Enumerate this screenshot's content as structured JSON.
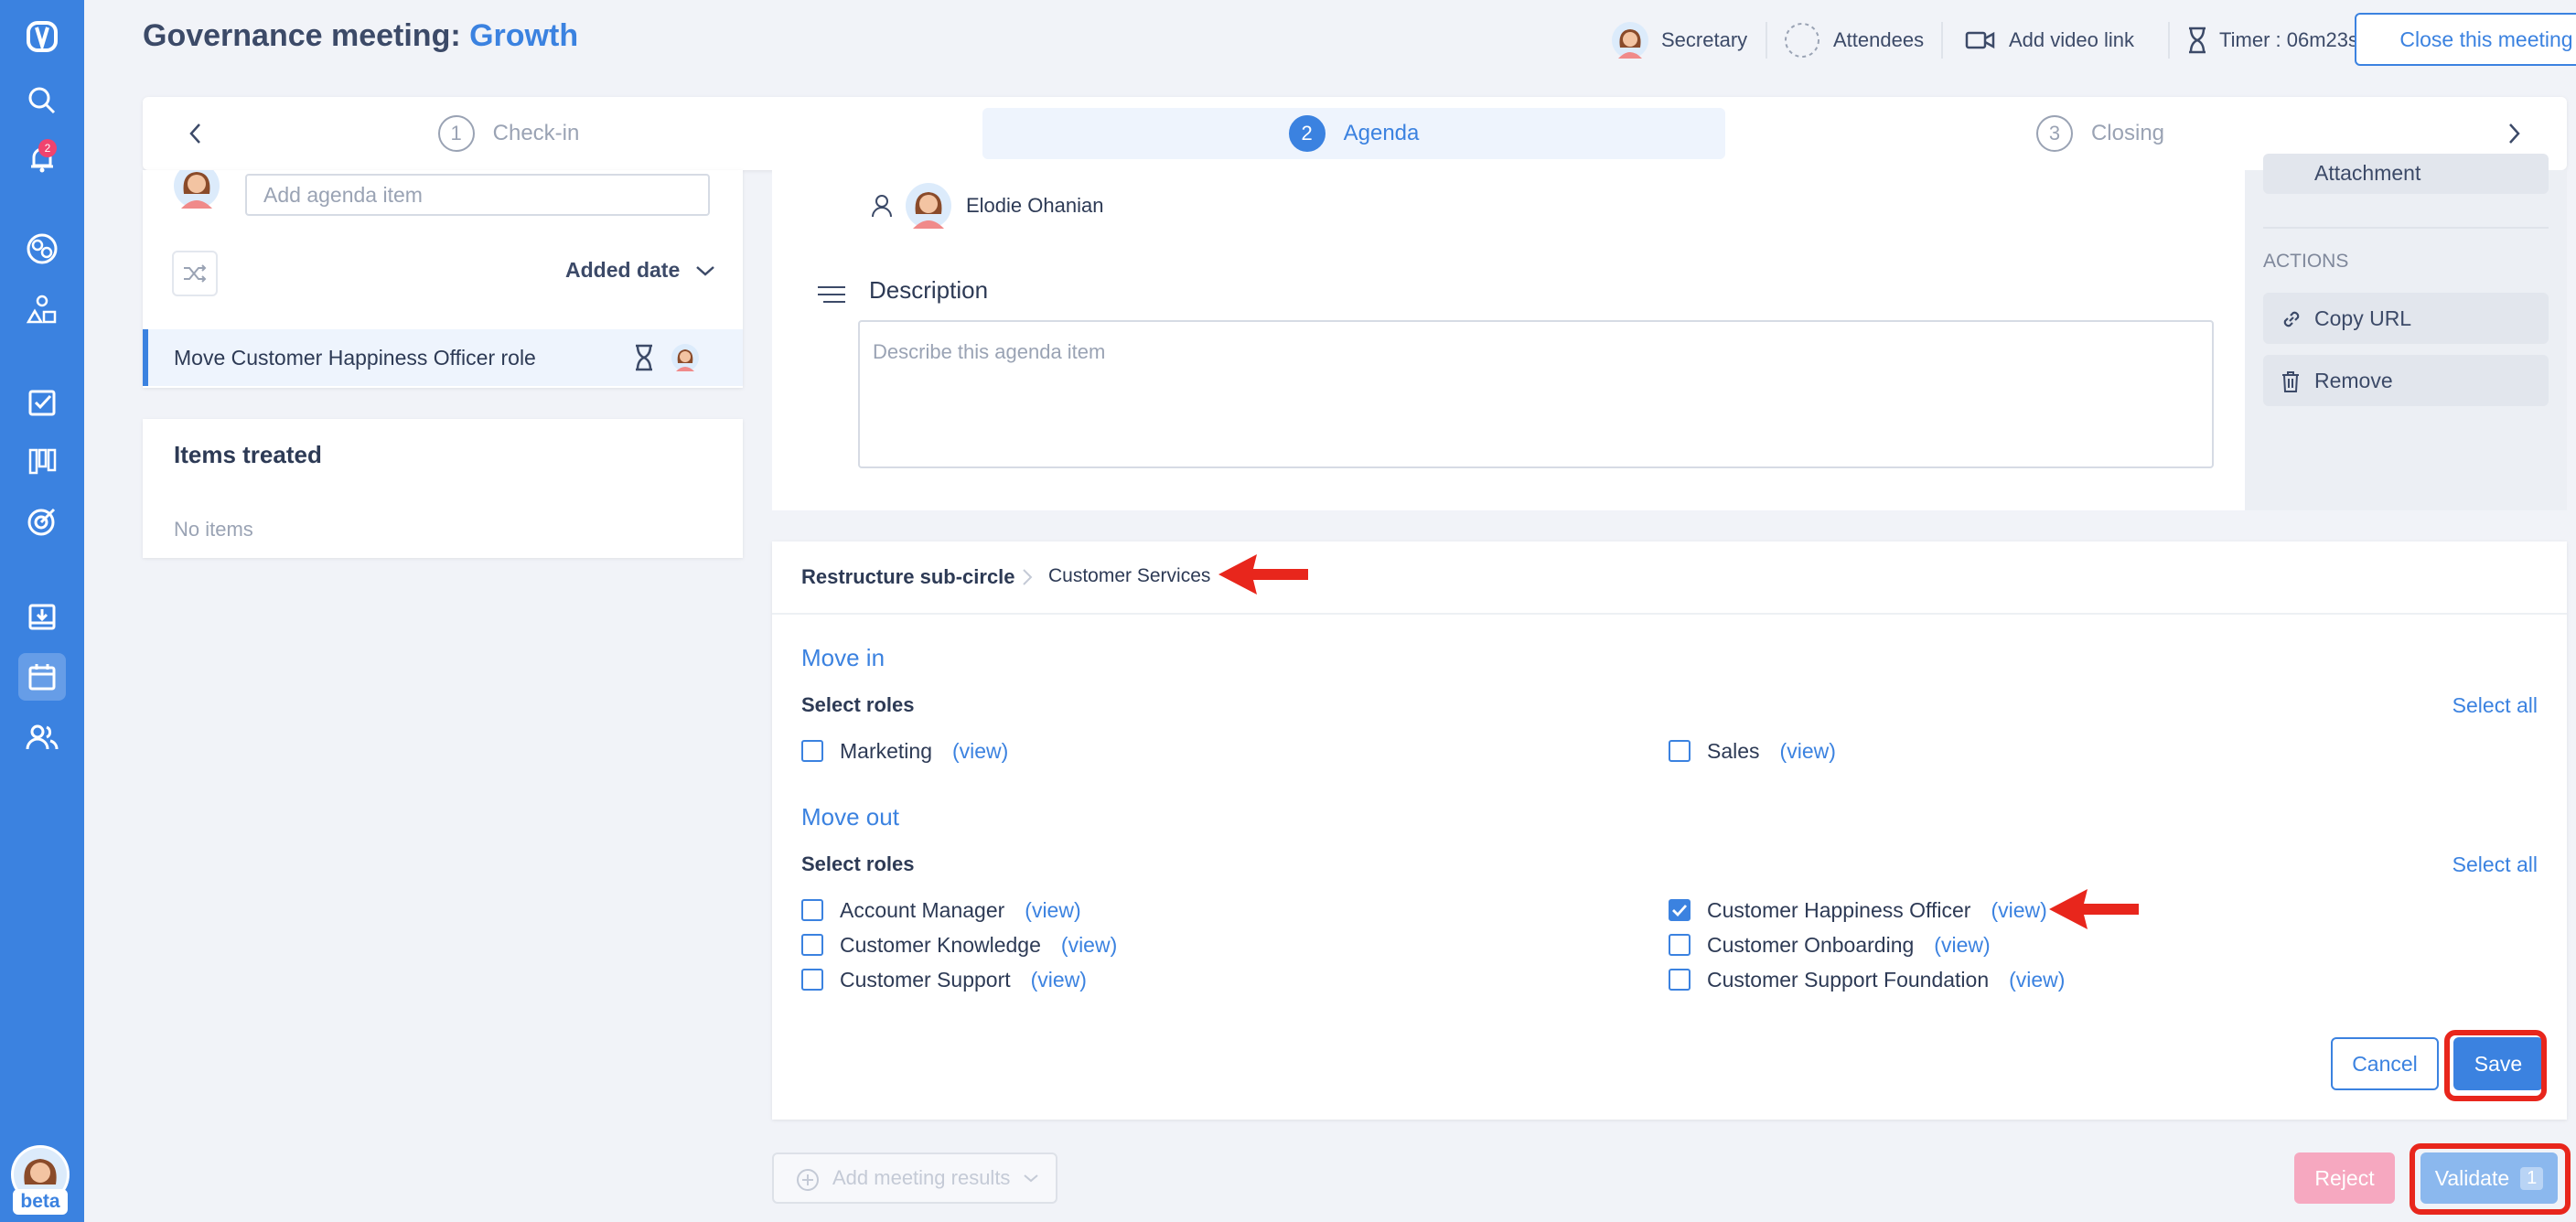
{
  "header": {
    "title_prefix": "Governance meeting: ",
    "title_accent": "Growth",
    "secretary_label": "Secretary",
    "attendees_label": "Attendees",
    "video_label": "Add video link",
    "timer_label": "Timer : 06m23s",
    "close_label": "Close this meeting"
  },
  "sidebar": {
    "notification_count": "2",
    "beta_label": "beta"
  },
  "stepper": {
    "steps": [
      {
        "num": "1",
        "label": "Check-in"
      },
      {
        "num": "2",
        "label": "Agenda"
      },
      {
        "num": "3",
        "label": "Closing"
      }
    ]
  },
  "agenda": {
    "input_placeholder": "Add agenda item",
    "sort_label": "Added date",
    "items": [
      {
        "label": "Move Customer Happiness Officer role"
      }
    ]
  },
  "items_treated": {
    "title": "Items treated",
    "empty_label": "No items"
  },
  "detail": {
    "assignee_name": "Elodie Ohanian",
    "description_label": "Description",
    "description_placeholder": "Describe this agenda item"
  },
  "actions": {
    "attachment_label": "Attachment",
    "section_label": "ACTIONS",
    "copy_url_label": "Copy URL",
    "remove_label": "Remove"
  },
  "restructure": {
    "breadcrumb_parent": "Restructure sub-circle",
    "breadcrumb_child": "Customer Services",
    "view_text": "(view)",
    "move_in": {
      "title": "Move in",
      "select_label": "Select roles",
      "select_all": "Select all",
      "roles": [
        {
          "name": "Marketing",
          "checked": false
        },
        {
          "name": "Sales",
          "checked": false
        }
      ]
    },
    "move_out": {
      "title": "Move out",
      "select_label": "Select roles",
      "select_all": "Select all",
      "roles": [
        {
          "name": "Account Manager",
          "checked": false
        },
        {
          "name": "Customer Knowledge",
          "checked": false
        },
        {
          "name": "Customer Support",
          "checked": false
        },
        {
          "name": "Customer Happiness Officer",
          "checked": true
        },
        {
          "name": "Customer Onboarding",
          "checked": false
        },
        {
          "name": "Customer Support Foundation",
          "checked": false
        }
      ]
    },
    "cancel_label": "Cancel",
    "save_label": "Save"
  },
  "footer": {
    "add_results_label": "Add meeting results",
    "reject_label": "Reject",
    "validate_label": "Validate",
    "validate_count": "1"
  },
  "colors": {
    "accent": "#3b82e0",
    "annotation_red": "#e8261c",
    "reject_pink": "#f6a8c0"
  },
  "icons": {
    "sidebar": [
      "logo-icon",
      "search-icon",
      "bell-icon",
      "circles-icon",
      "shapes-icon",
      "checklist-icon",
      "board-icon",
      "target-icon",
      "inbox-icon",
      "calendar-icon",
      "people-icon"
    ]
  }
}
